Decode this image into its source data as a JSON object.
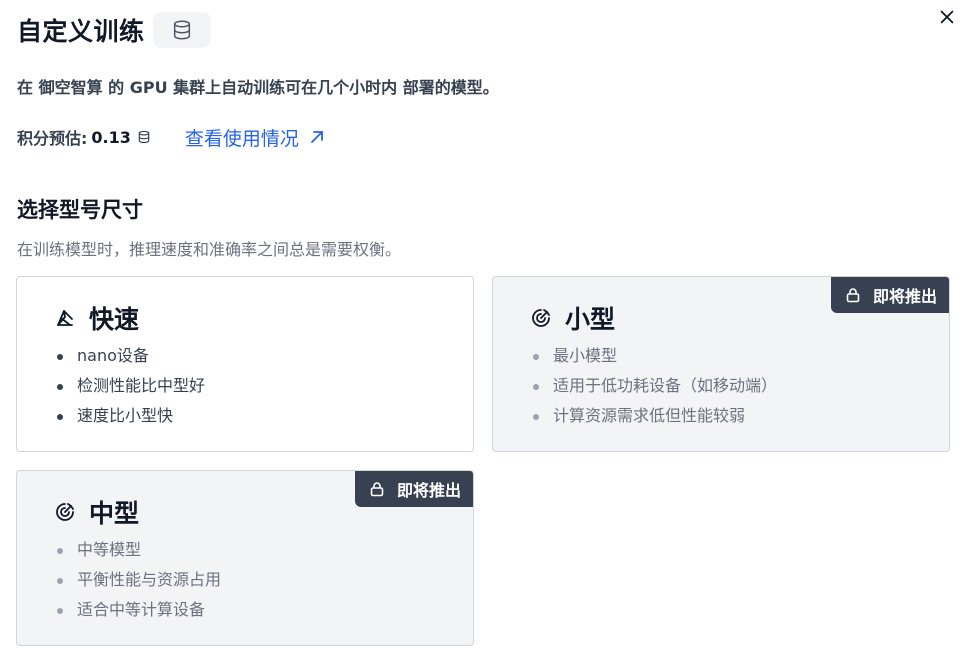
{
  "header": {
    "title": "自定义训练",
    "subtitle": "在 御空智算 的 GPU 集群上自动训练可在几个小时内 部署的模型。",
    "credits_label": "积分预估:",
    "credits_value": "0.13",
    "usage_link": "查看使用情况"
  },
  "section": {
    "title": "选择型号尺寸",
    "description": "在训练模型时，推理速度和准确率之间总是需要权衡。"
  },
  "cards": [
    {
      "title": "快速",
      "icon": "fast-model-icon",
      "disabled": false,
      "features": [
        "nano设备",
        "检测性能比中型好",
        "速度比小型快"
      ]
    },
    {
      "title": "小型",
      "icon": "model-size-icon",
      "disabled": true,
      "badge": "即将推出",
      "features": [
        "最小模型",
        "适用于低功耗设备（如移动端）",
        "计算资源需求低但性能较弱"
      ]
    },
    {
      "title": "中型",
      "icon": "model-size-icon",
      "disabled": true,
      "badge": "即将推出",
      "features": [
        "中等模型",
        "平衡性能与资源占用",
        "适合中等计算设备"
      ]
    }
  ],
  "colors": {
    "link": "#2563eb",
    "badge_bg": "#374151",
    "disabled_card_bg": "#f3f4f6"
  }
}
